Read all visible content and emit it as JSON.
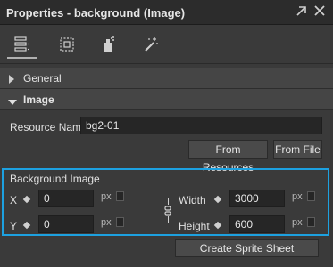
{
  "window": {
    "title": "Properties - background (Image)",
    "pin_icon": "pin-arrow-icon",
    "close_icon": "close-icon"
  },
  "toolbar": {
    "tools": [
      {
        "name": "properties-tool",
        "icon": "list-properties-icon"
      },
      {
        "name": "layout-tool",
        "icon": "dotted-square-icon"
      },
      {
        "name": "physics-tool",
        "icon": "spray-bottle-icon"
      },
      {
        "name": "effects-tool",
        "icon": "magic-wand-icon"
      }
    ]
  },
  "sections": {
    "general": {
      "label": "General",
      "expanded": false
    },
    "image": {
      "label": "Image",
      "expanded": true
    }
  },
  "resource": {
    "label": "Resource Name",
    "value": "bg2-01",
    "from_resources": "From Resources",
    "from_file": "From File"
  },
  "background_image": {
    "title": "Background Image",
    "x": {
      "label": "X",
      "value": "0",
      "unit": "px"
    },
    "y": {
      "label": "Y",
      "value": "0",
      "unit": "px"
    },
    "width": {
      "label": "Width",
      "value": "3000",
      "unit": "px"
    },
    "height": {
      "label": "Height",
      "value": "600",
      "unit": "px"
    }
  },
  "sprite_sheet_button": "Create Sprite Sheet",
  "colors": {
    "accent": "#1da1e0",
    "background": "#3a3a3a",
    "field": "#262626"
  }
}
